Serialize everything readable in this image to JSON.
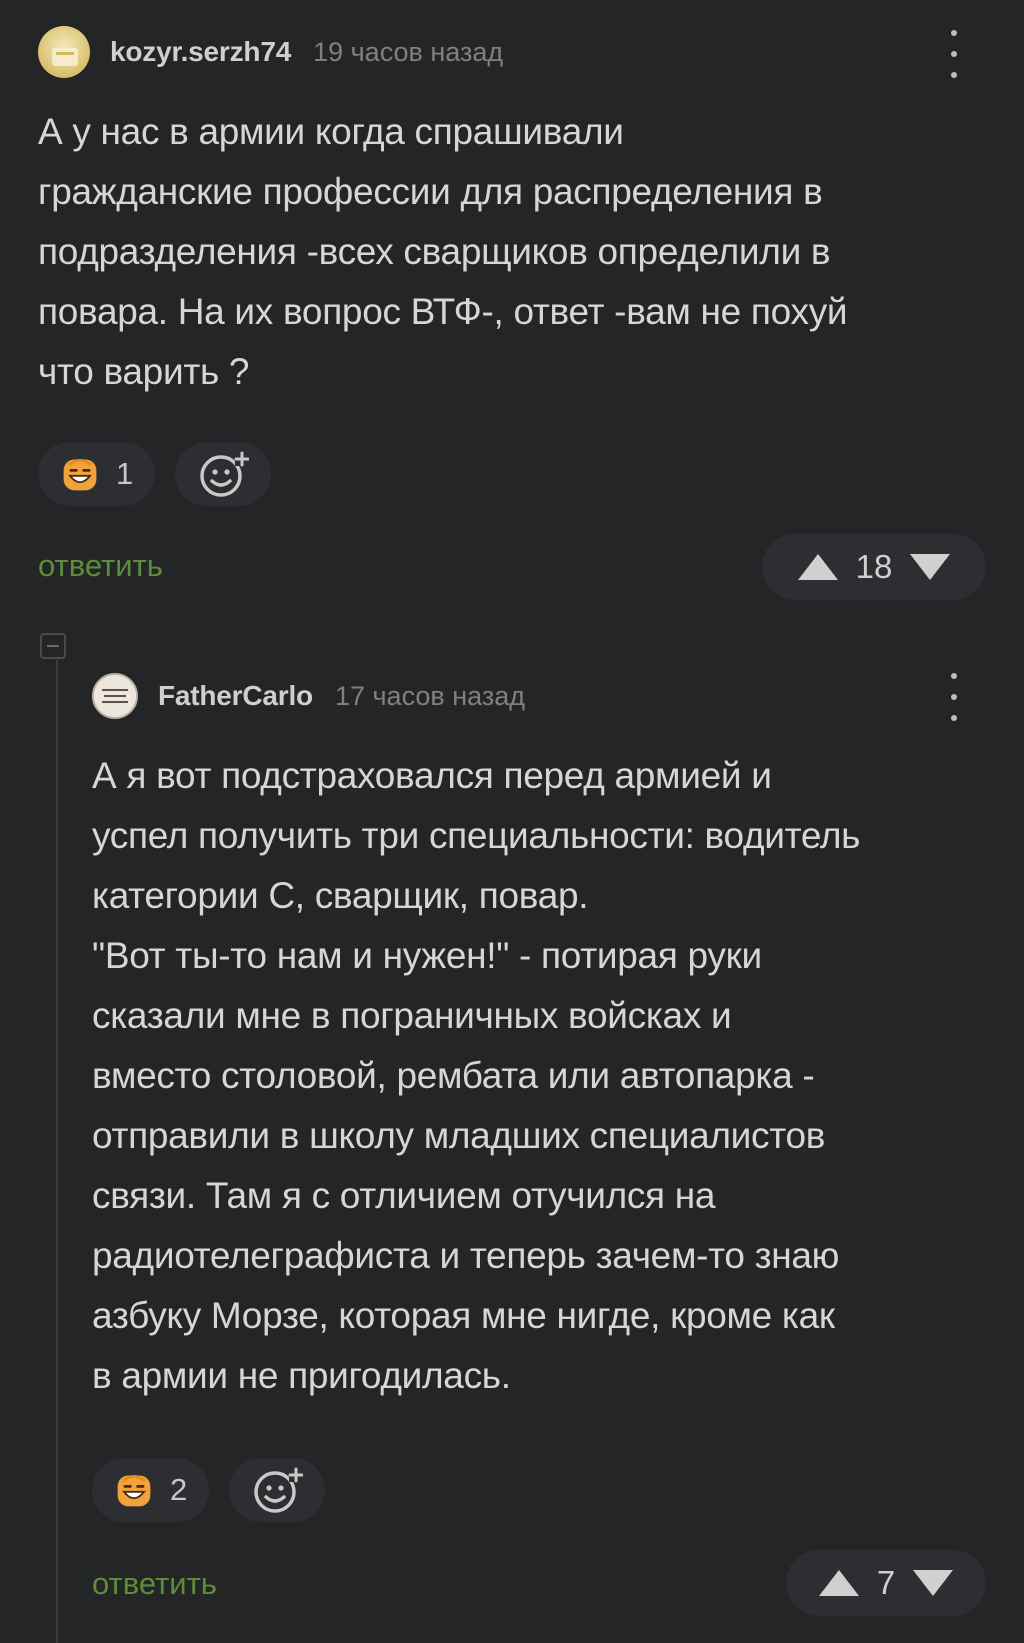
{
  "comment1": {
    "author": "kozyr.serzh74",
    "time": "19 часов назад",
    "text": "А у нас в армии когда спрашивали\nгражданские профессии для распределения в\nподразделения -всех сварщиков определили в\nповара. На их вопрос ВТФ-, ответ -вам не похуй\nчто варить ?",
    "reaction_count": "1",
    "reply_label": "ответить",
    "rating": "18"
  },
  "comment2": {
    "author": "FatherCarlo",
    "time": "17 часов назад",
    "text": "А я вот подстраховался перед армией и\nуспел получить три специальности: водитель\nкатегории С, сварщик, повар.\n\"Вот ты-то нам и нужен!\" - потирая руки\nсказали мне в пограничных войсках и\nвместо столовой, рембата или автопарка -\nотправили в школу младших специалистов\nсвязи. Там я с отличием отучился на\nрадиотелеграфиста и теперь зачем-то знаю\nазбуку Морзе, которая мне нигде, кроме как\nв армии не пригодилась.",
    "reaction_count": "2",
    "reply_label": "ответить",
    "rating": "7"
  },
  "icons": {
    "menu": "more-vertical-icon",
    "reaction": "grinning-face-emoji-icon",
    "add_reaction": "add-emoji-icon",
    "upvote": "upvote-triangle-icon",
    "downvote": "downvote-triangle-icon",
    "collapse": "collapse-thread-icon"
  },
  "colors": {
    "background": "#242527",
    "reply_link": "#5e8d3a",
    "text": "#d6d6d6",
    "muted": "#7f8082",
    "reaction_emoji": "#f0a33a"
  }
}
